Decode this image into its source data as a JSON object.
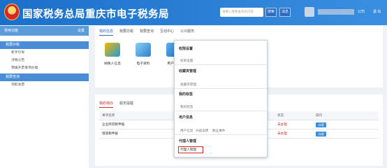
{
  "header": {
    "title": "国家税务总局重庆市电子税务局",
    "search_placeholder": "请输入需要查找的内容",
    "search_button": "搜索",
    "msg_button": "消息",
    "corp_label": "公司",
    "exit_label": "退 出"
  },
  "sidebar": {
    "header_label": "常用功能",
    "header_action": "设置",
    "groups": [
      {
        "label": "我要办税",
        "items": [
          "新手引导",
          "涉税公告",
          "预填开票事项办理"
        ]
      },
      {
        "label": "我要查询",
        "items": [
          "领取发票"
        ]
      }
    ]
  },
  "main": {
    "tabs": [
      "我的信息",
      "我要办税",
      "我要查询",
      "互动中心",
      "公众服务"
    ],
    "apps": [
      "纳税人信息",
      "电子资料",
      "用户管理"
    ],
    "subtabs": [
      "我的待办",
      "服务提醒"
    ],
    "table": {
      "headers": [
        "事项名称",
        "状态",
        "操作"
      ],
      "rows": [
        {
          "name": "企业所得税申报",
          "status": "未办理",
          "action": "办理"
        },
        {
          "name": "增值税申报",
          "status": "未办理",
          "action": "办理"
        }
      ]
    }
  },
  "dropdown": {
    "sections": [
      {
        "title": "权限设置",
        "items": [
          "权限设置"
        ]
      },
      {
        "title": "收藏夹管理",
        "items": [
          "收藏夹管理"
        ]
      },
      {
        "title": "我的标签",
        "items": [
          "我的标签"
        ]
      },
      {
        "title": "用户信息",
        "items": [
          "用户信息",
          "升级说明",
          "数证事件"
        ]
      },
      {
        "title": "代理人管理",
        "items": [
          "代理人管理"
        ]
      }
    ]
  },
  "colors": {
    "header_blue": "#1a6fc9",
    "accent_red": "#d9262b",
    "link_blue": "#2a6ecf"
  }
}
